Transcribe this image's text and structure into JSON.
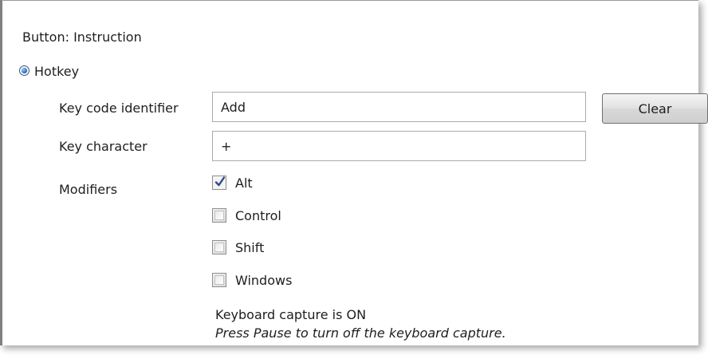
{
  "section": {
    "title": "Button: Instruction"
  },
  "hotkey": {
    "label": "Hotkey",
    "selected": true
  },
  "fields": {
    "key_code_label": "Key code identifier",
    "key_code_value": "Add",
    "key_char_label": "Key character",
    "key_char_value": "+",
    "clear_label": "Clear"
  },
  "modifiers": {
    "label": "Modifiers",
    "items": [
      {
        "label": "Alt",
        "checked": true
      },
      {
        "label": "Control",
        "checked": false
      },
      {
        "label": "Shift",
        "checked": false
      },
      {
        "label": "Windows",
        "checked": false
      }
    ]
  },
  "capture": {
    "status": "Keyboard capture is ON",
    "hint": "Press Pause to turn off the keyboard capture."
  },
  "colors": {
    "radio_accent": "#1c5fb0",
    "check_accent": "#2c4a8a"
  }
}
